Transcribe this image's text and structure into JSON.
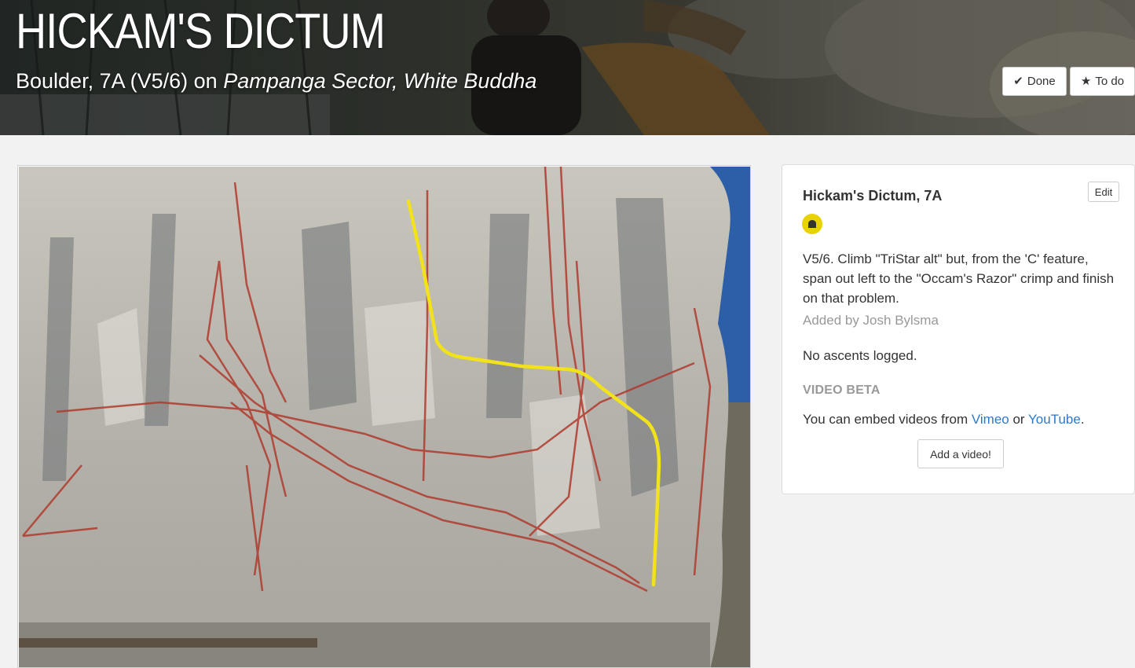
{
  "route": {
    "title": "HICKAM'S DICTUM",
    "subtitle_prefix": "Boulder, 7A (V5/6) on ",
    "subtitle_location": "Pampanga Sector, White Buddha"
  },
  "header_actions": {
    "done_label": "Done",
    "done_icon": "checkmark-icon",
    "todo_label": "To do",
    "todo_icon": "star-icon"
  },
  "panel": {
    "title": "Hickam's Dictum, 7A",
    "edit_label": "Edit",
    "grade_color": "#e8d300",
    "description": "V5/6. Climb \"TriStar alt\" but, from the 'C' feature, span out left to the \"Occam's Razor\" crimp and finish on that problem.",
    "added_by": "Added by Josh Bylsma",
    "ascents": "No ascents logged.",
    "video_beta": {
      "heading": "VIDEO BETA",
      "text_before": "You can embed videos from ",
      "link_vimeo": "Vimeo",
      "text_middle": " or ",
      "link_youtube": "YouTube",
      "text_after": ".",
      "add_button": "Add a video!"
    }
  },
  "topo": {
    "highlight_color": "#f2e21b",
    "other_lines_color": "#b03a2e"
  }
}
